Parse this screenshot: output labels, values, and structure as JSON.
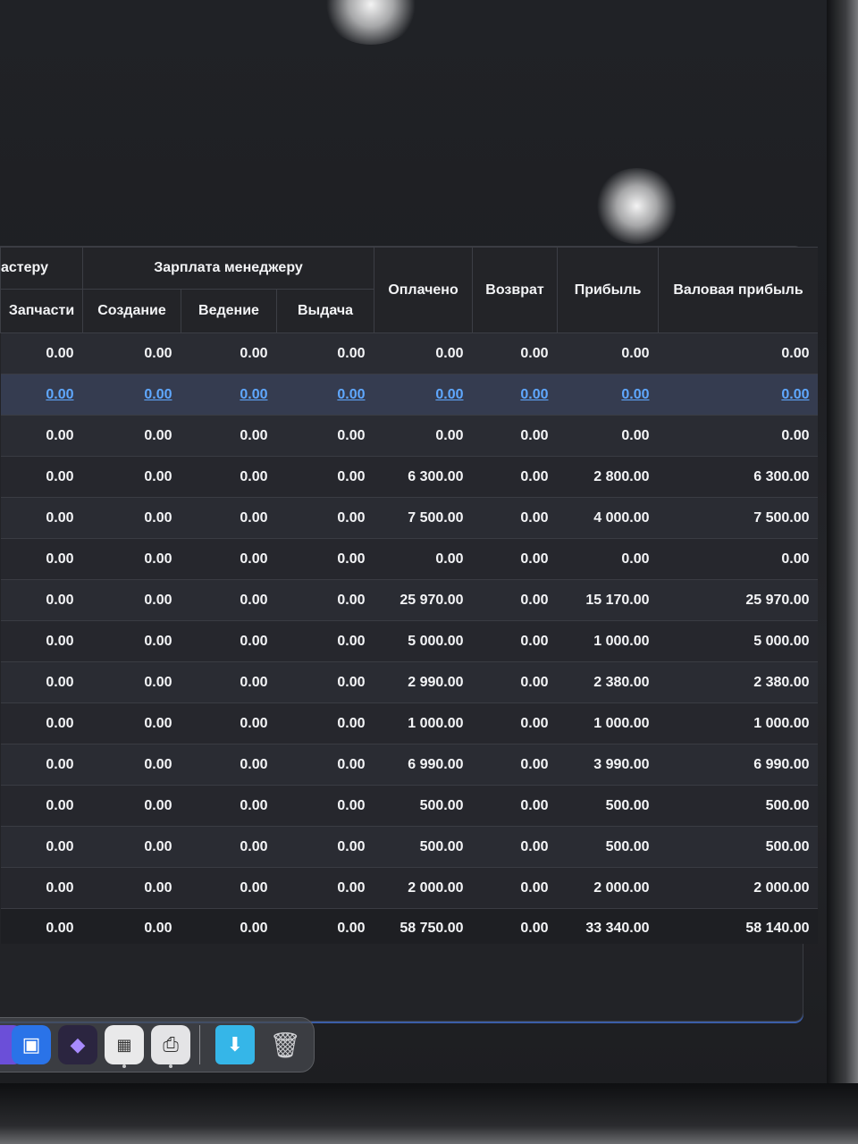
{
  "table": {
    "group_headers": {
      "master": "астеру",
      "manager": "Зарплата менеджеру"
    },
    "columns": [
      "Запчасти",
      "Создание",
      "Ведение",
      "Выдача",
      "Оплачено",
      "Возврат",
      "Прибыль",
      "Валовая прибыль"
    ],
    "rows": [
      [
        "0.00",
        "0.00",
        "0.00",
        "0.00",
        "0.00",
        "0.00",
        "0.00",
        "0.00"
      ],
      [
        "0.00",
        "0.00",
        "0.00",
        "0.00",
        "0.00",
        "0.00",
        "0.00",
        "0.00"
      ],
      [
        "0.00",
        "0.00",
        "0.00",
        "0.00",
        "0.00",
        "0.00",
        "0.00",
        "0.00"
      ],
      [
        "0.00",
        "0.00",
        "0.00",
        "0.00",
        "6 300.00",
        "0.00",
        "2 800.00",
        "6 300.00"
      ],
      [
        "0.00",
        "0.00",
        "0.00",
        "0.00",
        "7 500.00",
        "0.00",
        "4 000.00",
        "7 500.00"
      ],
      [
        "0.00",
        "0.00",
        "0.00",
        "0.00",
        "0.00",
        "0.00",
        "0.00",
        "0.00"
      ],
      [
        "0.00",
        "0.00",
        "0.00",
        "0.00",
        "25 970.00",
        "0.00",
        "15 170.00",
        "25 970.00"
      ],
      [
        "0.00",
        "0.00",
        "0.00",
        "0.00",
        "5 000.00",
        "0.00",
        "1 000.00",
        "5 000.00"
      ],
      [
        "0.00",
        "0.00",
        "0.00",
        "0.00",
        "2 990.00",
        "0.00",
        "2 380.00",
        "2 380.00"
      ],
      [
        "0.00",
        "0.00",
        "0.00",
        "0.00",
        "1 000.00",
        "0.00",
        "1 000.00",
        "1 000.00"
      ],
      [
        "0.00",
        "0.00",
        "0.00",
        "0.00",
        "6 990.00",
        "0.00",
        "3 990.00",
        "6 990.00"
      ],
      [
        "0.00",
        "0.00",
        "0.00",
        "0.00",
        "500.00",
        "0.00",
        "500.00",
        "500.00"
      ],
      [
        "0.00",
        "0.00",
        "0.00",
        "0.00",
        "500.00",
        "0.00",
        "500.00",
        "500.00"
      ],
      [
        "0.00",
        "0.00",
        "0.00",
        "0.00",
        "2 000.00",
        "0.00",
        "2 000.00",
        "2 000.00"
      ]
    ],
    "selected_row": 1,
    "total": [
      "0.00",
      "0.00",
      "0.00",
      "0.00",
      "58 750.00",
      "0.00",
      "33 340.00",
      "58 140.00"
    ]
  },
  "dock": {
    "icons": [
      "Finder-like",
      "Obsidian",
      "Calculator",
      "Printer",
      "Downloads folder",
      "Trash"
    ]
  },
  "colors": {
    "link": "#5fa8ff",
    "selected_row_bg": "#353c50",
    "table_bg": "#26272d"
  }
}
